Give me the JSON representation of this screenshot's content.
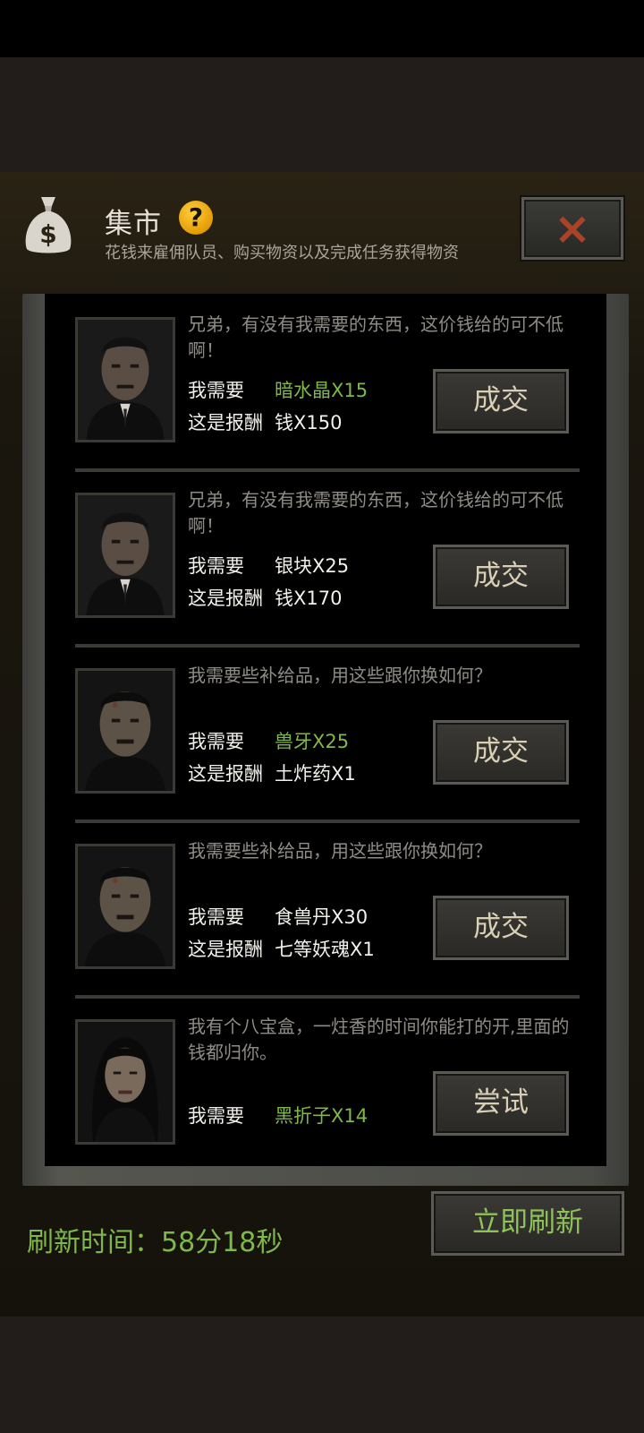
{
  "header": {
    "title": "集市",
    "help_icon": "?",
    "subtitle": "花钱来雇佣队员、购买物资以及完成任务获得物资",
    "close_icon": "×"
  },
  "offers": [
    {
      "portrait": "man-in-suit-portrait",
      "quote": "兄弟，有没有我需要的东西，这价钱给的可不低啊！",
      "need_label": "我需要",
      "need_value": "暗水晶X15",
      "need_color": "green",
      "reward_label": "这是报酬",
      "reward_value": "钱X150",
      "button": "成交"
    },
    {
      "portrait": "man-in-suit-portrait",
      "quote": "兄弟，有没有我需要的东西，这价钱给的可不低啊！",
      "need_label": "我需要",
      "need_value": "银块X25",
      "need_color": "white",
      "reward_label": "这是报酬",
      "reward_value": "钱X170",
      "button": "成交"
    },
    {
      "portrait": "bruised-man-portrait",
      "quote": "我需要些补给品，用这些跟你换如何？",
      "need_label": "我需要",
      "need_value": "兽牙X25",
      "need_color": "green",
      "reward_label": "这是报酬",
      "reward_value": "土炸药X1",
      "button": "成交"
    },
    {
      "portrait": "bruised-man-portrait",
      "quote": "我需要些补给品，用这些跟你换如何？",
      "need_label": "我需要",
      "need_value": "食兽丹X30",
      "need_color": "white",
      "reward_label": "这是报酬",
      "reward_value": "七等妖魂X1",
      "button": "成交"
    },
    {
      "portrait": "woman-portrait",
      "quote": "我有个八宝盒，一炷香的时间你能打的开,里面的钱都归你。",
      "need_label": "我需要",
      "need_value": "黑折子X14",
      "need_color": "green",
      "reward_label": "",
      "reward_value": "",
      "button": "尝试"
    }
  ],
  "footer": {
    "refresh_label": "刷新时间：58分18秒",
    "refresh_button": "立即刷新"
  },
  "colors": {
    "accent_green": "#7fb84a",
    "close_red": "#a8432a",
    "help_yellow": "#f2b01a"
  }
}
